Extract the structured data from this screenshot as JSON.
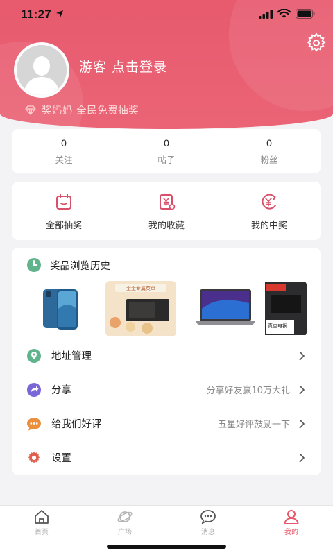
{
  "status_bar": {
    "time": "11:27"
  },
  "profile": {
    "login_text": "游客 点击登录",
    "promo_text": "奖妈妈 全民免费抽奖"
  },
  "stats": [
    {
      "value": "0",
      "label": "关注"
    },
    {
      "value": "0",
      "label": "帖子"
    },
    {
      "value": "0",
      "label": "粉丝"
    }
  ],
  "shortcuts": [
    {
      "label": "全部抽奖",
      "icon": "calendar-icon"
    },
    {
      "label": "我的收藏",
      "icon": "yen-doc-icon"
    },
    {
      "label": "我的中奖",
      "icon": "yen-coin-icon"
    }
  ],
  "history": {
    "title": "奖品浏览历史",
    "products": [
      {
        "name": "iphone",
        "image_text": ""
      },
      {
        "name": "microwave",
        "image_text": "宝宝专属菜单"
      },
      {
        "name": "macbook",
        "image_text": ""
      },
      {
        "name": "vacuum-sealer",
        "image_text": "真空电锅"
      }
    ]
  },
  "menu": [
    {
      "label": "地址管理",
      "sub": "",
      "icon": "location-pin-icon"
    },
    {
      "label": "分享",
      "sub": "分享好友赢10万大礼",
      "icon": "share-icon"
    },
    {
      "label": "给我们好评",
      "sub": "五星好评鼓励一下",
      "icon": "chat-bubble-icon"
    },
    {
      "label": "设置",
      "sub": "",
      "icon": "settings-icon"
    }
  ],
  "tabs": [
    {
      "label": "首页",
      "icon": "home-icon",
      "active": false
    },
    {
      "label": "广场",
      "icon": "planet-icon",
      "active": false
    },
    {
      "label": "消息",
      "icon": "message-icon",
      "active": false
    },
    {
      "label": "我的",
      "icon": "user-icon",
      "active": true
    }
  ],
  "colors": {
    "accent": "#e8576b",
    "header": "#e85a6e",
    "background": "#f3f3f5"
  }
}
